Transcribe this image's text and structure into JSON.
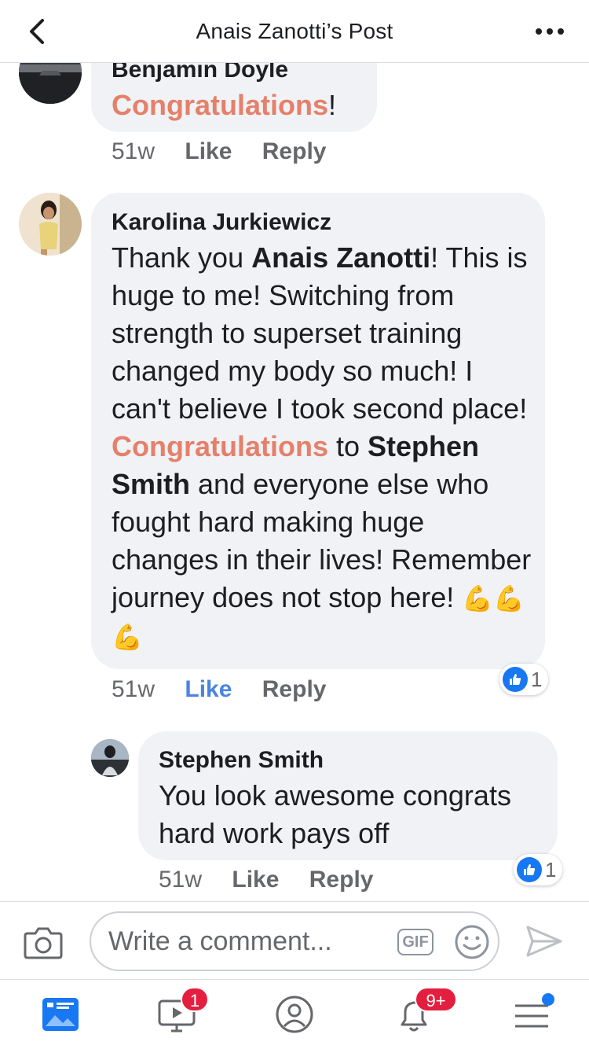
{
  "header": {
    "title": "Anais Zanotti’s Post"
  },
  "comments": [
    {
      "author": "Benjamin Doyle",
      "text_highlight": "Congratulations",
      "text_after": "!",
      "time": "51w",
      "like": "Like",
      "reply": "Reply"
    },
    {
      "author": "Karolina Jurkiewicz",
      "parts": {
        "p1": "Thank you ",
        "mention1": "Anais Zanotti",
        "p2": "! This is huge to me! Switching from strength to superset training changed my body so much! I can't believe I took second place! ",
        "highlight": "Congratulations",
        "p3": " to ",
        "mention2": "Stephen Smith",
        "p4": " and everyone else who fought hard making huge changes in their lives! Remember journey does not stop here! ",
        "emoji": "💪💪💪"
      },
      "time": "51w",
      "like": "Like",
      "reply": "Reply",
      "reaction_count": "1"
    },
    {
      "author": "Stephen Smith",
      "text": "You look awesome congrats hard work pays off",
      "time": "51w",
      "like": "Like",
      "reply": "Reply",
      "reaction_count": "1"
    }
  ],
  "composer": {
    "placeholder": "Write a comment...",
    "gif_label": "GIF"
  },
  "nav": {
    "video_badge": "1",
    "notifications_badge": "9+"
  },
  "colors": {
    "highlight": "#e5806a",
    "accent": "#1877f2",
    "bubble": "#f0f2f5",
    "badge": "#e41e3f"
  }
}
